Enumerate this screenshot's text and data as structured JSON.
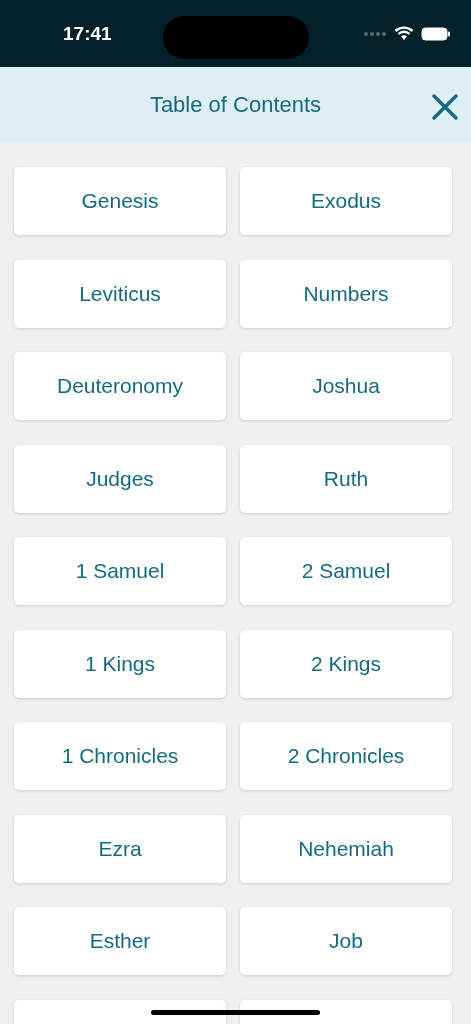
{
  "status_bar": {
    "time": "17:41"
  },
  "header": {
    "title": "Table of Contents"
  },
  "books": [
    {
      "label": "Genesis"
    },
    {
      "label": "Exodus"
    },
    {
      "label": "Leviticus"
    },
    {
      "label": "Numbers"
    },
    {
      "label": "Deuteronomy"
    },
    {
      "label": "Joshua"
    },
    {
      "label": "Judges"
    },
    {
      "label": "Ruth"
    },
    {
      "label": "1 Samuel"
    },
    {
      "label": "2 Samuel"
    },
    {
      "label": "1 Kings"
    },
    {
      "label": "2 Kings"
    },
    {
      "label": "1 Chronicles"
    },
    {
      "label": "2 Chronicles"
    },
    {
      "label": "Ezra"
    },
    {
      "label": "Nehemiah"
    },
    {
      "label": "Esther"
    },
    {
      "label": "Job"
    }
  ]
}
